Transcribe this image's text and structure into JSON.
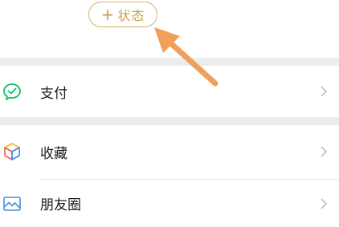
{
  "status_button": {
    "plus": "+",
    "label": "状态"
  },
  "menu": {
    "items": [
      {
        "label": "支付",
        "icon": "wechat-pay-icon",
        "color": "#07c160"
      },
      {
        "label": "收藏",
        "icon": "favorites-cube-icon",
        "color": "#f2b62b"
      },
      {
        "label": "朋友圈",
        "icon": "moments-picture-icon",
        "color": "#4a90d9"
      }
    ]
  },
  "colors": {
    "pill_border": "#d6b36a",
    "pill_text": "#c9a14f",
    "arrow": "#f0a05a",
    "separator": "#ededed"
  }
}
